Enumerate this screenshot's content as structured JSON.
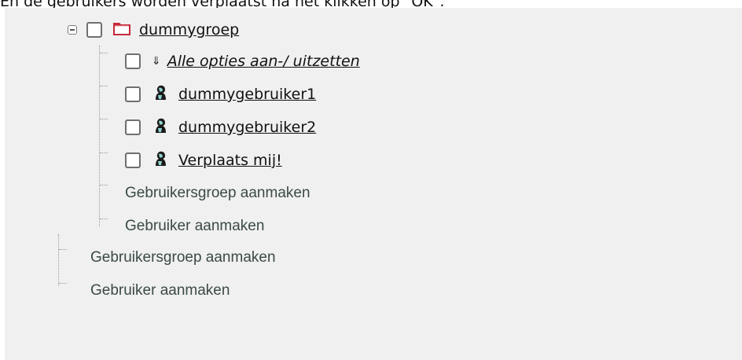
{
  "caption": "En de gebruikers worden verplaatst na het klikken op \"OK\".",
  "tree": {
    "group": {
      "label": "dummygroep",
      "expanded": true
    },
    "toggle_all": {
      "arrow": "⇓",
      "label": "Alle opties aan-/ uitzetten"
    },
    "users": [
      {
        "label": "dummygebruiker1",
        "icon": "user-icon"
      },
      {
        "label": "dummygebruiker2",
        "icon": "user-icon"
      },
      {
        "label": "Verplaats mij!",
        "icon": "user-icon"
      }
    ],
    "group_actions": {
      "create_group": "Gebruikersgroep aanmaken",
      "create_user": "Gebruiker aanmaken"
    },
    "root_actions": {
      "create_group": "Gebruikersgroep aanmaken",
      "create_user": "Gebruiker aanmaken"
    }
  },
  "colors": {
    "panel_bg": "#f0f0f0",
    "folder": "#c8283a",
    "action_text": "#3b4a44"
  }
}
